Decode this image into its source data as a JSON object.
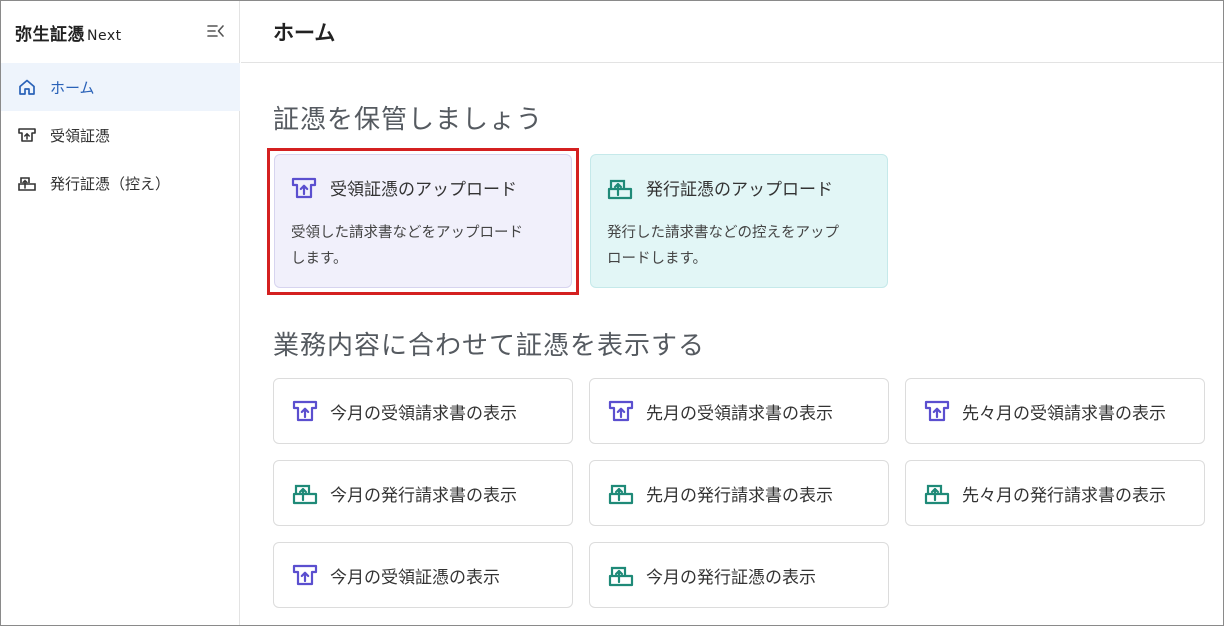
{
  "sidebar": {
    "brand": "弥生証憑",
    "brand_sub": "Next",
    "collapse_icon": "collapse-sidebar-icon",
    "items": [
      {
        "label": "ホーム",
        "icon": "home-icon",
        "active": true
      },
      {
        "label": "受領証憑",
        "icon": "received-voucher-icon",
        "active": false
      },
      {
        "label": "発行証憑（控え）",
        "icon": "issued-voucher-icon",
        "active": false
      }
    ]
  },
  "header": {
    "title": "ホーム"
  },
  "section_upload": {
    "title": "証憑を保管しましょう",
    "cards": [
      {
        "title": "受領証憑のアップロード",
        "desc1": "受領した請求書などをアップロード",
        "desc2": "します。",
        "icon": "upload-received-icon"
      },
      {
        "title": "発行証憑のアップロード",
        "desc1": "発行した請求書などの控えをアップ",
        "desc2": "ロードします。",
        "icon": "upload-issued-icon"
      }
    ]
  },
  "section_view": {
    "title": "業務内容に合わせて証憑を表示する",
    "buttons": [
      {
        "label": "今月の受領請求書の表示",
        "icon": "received-icon"
      },
      {
        "label": "先月の受領請求書の表示",
        "icon": "received-icon"
      },
      {
        "label": "先々月の受領請求書の表示",
        "icon": "received-icon"
      },
      {
        "label": "今月の発行請求書の表示",
        "icon": "issued-icon"
      },
      {
        "label": "先月の発行請求書の表示",
        "icon": "issued-icon"
      },
      {
        "label": "先々月の発行請求書の表示",
        "icon": "issued-icon"
      },
      {
        "label": "今月の受領証憑の表示",
        "icon": "received-icon"
      },
      {
        "label": "今月の発行証憑の表示",
        "icon": "issued-icon"
      }
    ]
  },
  "colors": {
    "accent_blue": "#2a62b8",
    "received_purple": "#5b4fcf",
    "issued_teal": "#1f8a78",
    "highlight_red": "#d42020"
  }
}
